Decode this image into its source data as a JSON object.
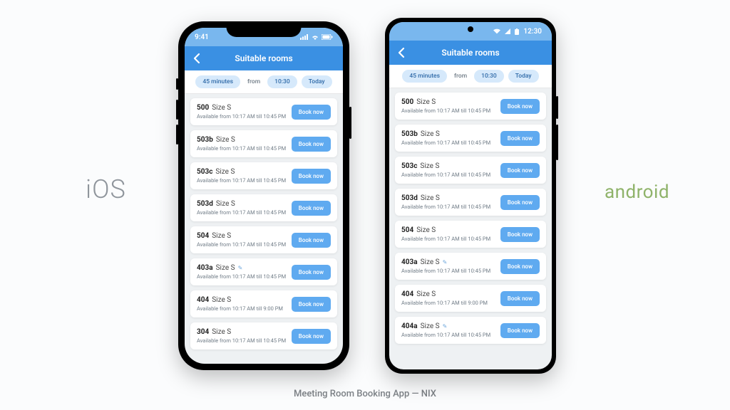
{
  "caption": "Meeting Room Booking App — NIX",
  "labels": {
    "ios": "iOS",
    "android": "android"
  },
  "ios": {
    "status_time": "9:41",
    "nav_title": "Suitable rooms",
    "filters": {
      "duration": "45 minutes",
      "from_label": "from",
      "time": "10:30",
      "day": "Today"
    },
    "book_label": "Book now",
    "rooms": [
      {
        "num": "500",
        "size": "Size S",
        "avail": "Available from 10:17 AM till 10:45 PM",
        "pencil": false
      },
      {
        "num": "503b",
        "size": "Size S",
        "avail": "Available from 10:17 AM till 10:45 PM",
        "pencil": false
      },
      {
        "num": "503c",
        "size": "Size S",
        "avail": "Available from 10:17 AM till 10:45 PM",
        "pencil": false
      },
      {
        "num": "503d",
        "size": "Size S",
        "avail": "Available from 10:17 AM till 10:45 PM",
        "pencil": false
      },
      {
        "num": "504",
        "size": "Size S",
        "avail": "Available from 10:17 AM till 10:45 PM",
        "pencil": false
      },
      {
        "num": "403a",
        "size": "Size S",
        "avail": "Available from 10:17 AM till 10:45 PM",
        "pencil": true
      },
      {
        "num": "404",
        "size": "Size S",
        "avail": "Available from 10:17 AM till 9:00 PM",
        "pencil": false
      },
      {
        "num": "304",
        "size": "Size S",
        "avail": "Available from 10:17 AM till 10:45 PM",
        "pencil": false
      }
    ]
  },
  "android": {
    "status_time": "12:30",
    "nav_title": "Suitable rooms",
    "filters": {
      "duration": "45 minutes",
      "from_label": "from",
      "time": "10:30",
      "day": "Today"
    },
    "book_label": "Book now",
    "rooms": [
      {
        "num": "500",
        "size": "Size S",
        "avail": "Available from 10:17 AM till 10:45 PM",
        "pencil": false
      },
      {
        "num": "503b",
        "size": "Size S",
        "avail": "Available from 10:17 AM till 10:45 PM",
        "pencil": false
      },
      {
        "num": "503c",
        "size": "Size S",
        "avail": "Available from 10:17 AM till 10:45 PM",
        "pencil": false
      },
      {
        "num": "503d",
        "size": "Size S",
        "avail": "Available from 10:17 AM till 10:45 PM",
        "pencil": false
      },
      {
        "num": "504",
        "size": "Size S",
        "avail": "Available from 10:17 AM till 10:45 PM",
        "pencil": false
      },
      {
        "num": "403a",
        "size": "Size S",
        "avail": "Available from 10:17 AM till 10:45 PM",
        "pencil": true
      },
      {
        "num": "404",
        "size": "Size S",
        "avail": "Available from 10:17 AM till 9:00 PM",
        "pencil": false
      },
      {
        "num": "404a",
        "size": "Size S",
        "avail": "Available from 10:17 AM till 10:45 PM",
        "pencil": true
      }
    ]
  }
}
